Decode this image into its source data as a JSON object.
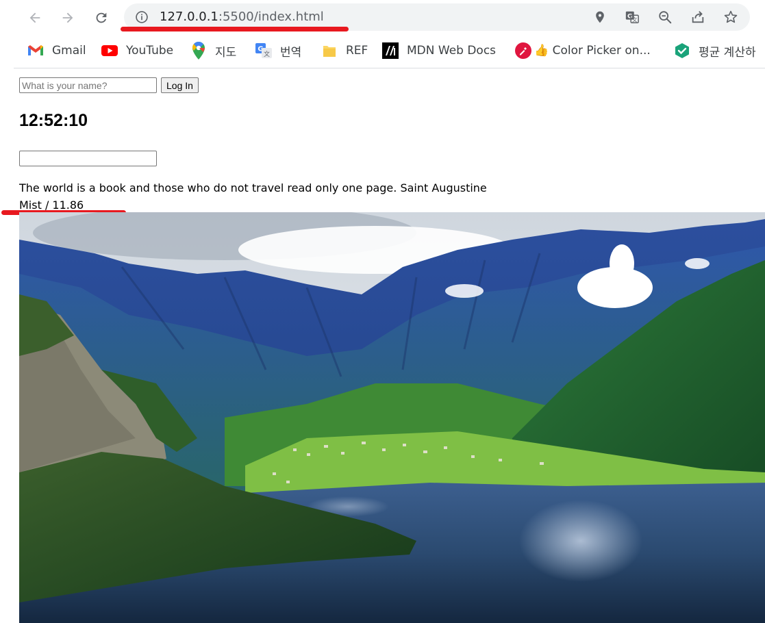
{
  "browser": {
    "url_host": "127.0.0.1",
    "url_path": ":5500/index.html",
    "icons": [
      "back-arrow-icon",
      "forward-arrow-icon",
      "reload-icon",
      "info-icon",
      "location-pin-icon",
      "translate-icon",
      "zoom-out-icon",
      "share-icon",
      "star-icon"
    ],
    "annotation_color": "#e8191f"
  },
  "bookmarks": [
    {
      "label": "Gmail",
      "icon": "gmail-icon"
    },
    {
      "label": "YouTube",
      "icon": "youtube-icon"
    },
    {
      "label": "지도",
      "icon": "maps-icon"
    },
    {
      "label": "번역",
      "icon": "translate-icon"
    },
    {
      "label": "REF",
      "icon": "folder-icon"
    },
    {
      "label": "MDN Web Docs",
      "icon": "mdn-icon"
    },
    {
      "label": "👍 Color Picker on...",
      "icon": "color-picker-icon"
    },
    {
      "label": "평균 계산하",
      "icon": "calculator-icon"
    }
  ],
  "page": {
    "login": {
      "placeholder": "What is your name?",
      "value": "",
      "button_label": "Log In"
    },
    "clock": "12:52:10",
    "todo_input_value": "",
    "quote": "The world is a book and those who do not travel read only one page. Saint Augustine",
    "weather": "Mist / 11.86",
    "background_image": "mountain-lake-landscape"
  }
}
